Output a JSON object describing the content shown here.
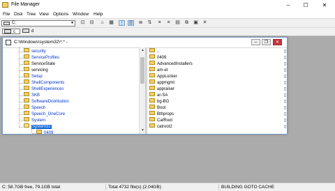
{
  "window": {
    "title": "File Manager",
    "controls": [
      "–",
      "☐",
      "✕"
    ]
  },
  "menu": [
    "File",
    "Disk",
    "Tree",
    "View",
    "Options",
    "Window",
    "Help"
  ],
  "toolbar": {
    "drive_value": "C:"
  },
  "drives": [
    {
      "label": "c"
    },
    {
      "label": "d"
    }
  ],
  "child": {
    "title": "C:\\Windows\\system32\\*.* -",
    "controls": [
      "–",
      "❐",
      "✕"
    ]
  },
  "tree": [
    {
      "name": "security",
      "link": true
    },
    {
      "name": "ServiceProfiles",
      "link": true
    },
    {
      "name": "ServiceState",
      "link": false
    },
    {
      "name": "servicing",
      "link": false
    },
    {
      "name": "Setup",
      "link": true
    },
    {
      "name": "ShellComponents",
      "link": true
    },
    {
      "name": "ShellExperiences",
      "link": true
    },
    {
      "name": "SKB",
      "link": true
    },
    {
      "name": "SoftwareDistribution",
      "link": true
    },
    {
      "name": "Speech",
      "link": true
    },
    {
      "name": "Speech_OneCore",
      "link": true
    },
    {
      "name": "System",
      "link": true
    },
    {
      "name": "System32",
      "link": false,
      "selected": true
    },
    {
      "name": "0409",
      "link": true,
      "child": true
    }
  ],
  "files": [
    {
      "name": ".."
    },
    {
      "name": "0409"
    },
    {
      "name": "AdvancedInstallers"
    },
    {
      "name": "am-et"
    },
    {
      "name": "AppLocker"
    },
    {
      "name": "appmgmt"
    },
    {
      "name": "appraiser"
    },
    {
      "name": "ar-SA"
    },
    {
      "name": "bg-BG"
    },
    {
      "name": "Boot"
    },
    {
      "name": "Bthprops"
    },
    {
      "name": "CatRoot"
    },
    {
      "name": "catroot2"
    }
  ],
  "status": {
    "free": "C: 58.7GB free,  79.1GB total",
    "total": "Total 4732 file(s) (2.04GB)",
    "message": "BUILDING GOTO CACHE"
  }
}
